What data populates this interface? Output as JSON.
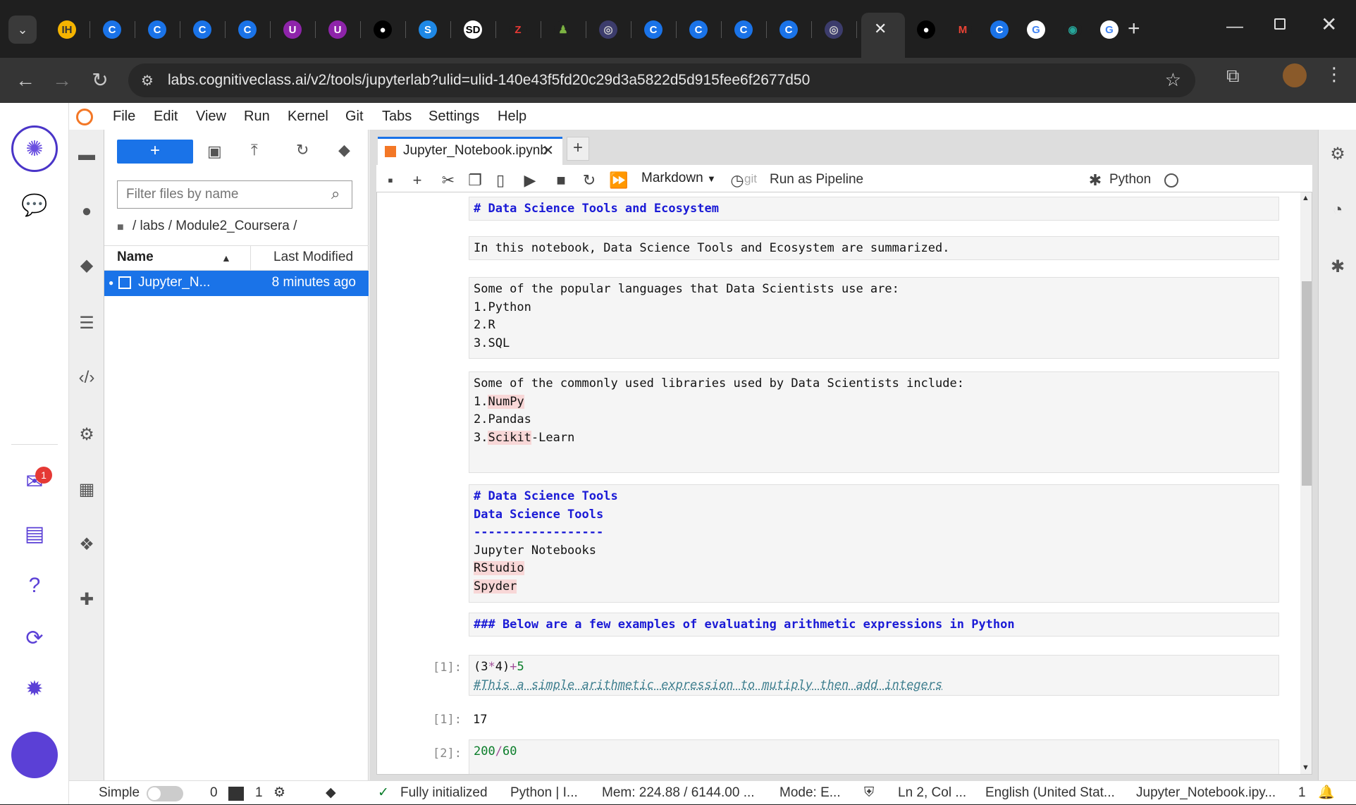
{
  "browser": {
    "tabs": [
      {
        "name": "ih-tab",
        "glyph": "IH",
        "color": "#f5b400",
        "text": "#333"
      },
      {
        "name": "cognitiveclass-tab",
        "glyph": "C",
        "color": "#1a73e8",
        "text": "#fff"
      },
      {
        "name": "cognitiveclass-tab",
        "glyph": "C",
        "color": "#1a73e8",
        "text": "#fff"
      },
      {
        "name": "cognitiveclass-tab",
        "glyph": "C",
        "color": "#1a73e8",
        "text": "#fff"
      },
      {
        "name": "cognitiveclass-tab",
        "glyph": "C",
        "color": "#1a73e8",
        "text": "#fff"
      },
      {
        "name": "u-tab",
        "glyph": "U",
        "color": "#8e24aa",
        "text": "#fff"
      },
      {
        "name": "u-tab",
        "glyph": "U",
        "color": "#8e24aa",
        "text": "#fff"
      },
      {
        "name": "github-tab",
        "glyph": "●",
        "color": "#000",
        "text": "#fff"
      },
      {
        "name": "s-tab",
        "glyph": "S",
        "color": "#1e88e5",
        "text": "#fff"
      },
      {
        "name": "sd-tab",
        "glyph": "SD",
        "color": "#fff",
        "text": "#000"
      },
      {
        "name": "z-tab",
        "glyph": "Z",
        "color": "#1f1f1f",
        "text": "#e53935"
      },
      {
        "name": "chess-tab",
        "glyph": "♟",
        "color": "#1f1f1f",
        "text": "#7cb342"
      },
      {
        "name": "circle-tab",
        "glyph": "◎",
        "color": "#3c3c6c",
        "text": "#ccc"
      },
      {
        "name": "cognitiveclass-tab",
        "glyph": "C",
        "color": "#1a73e8",
        "text": "#fff"
      },
      {
        "name": "cognitiveclass-tab",
        "glyph": "C",
        "color": "#1a73e8",
        "text": "#fff"
      },
      {
        "name": "cognitiveclass-tab",
        "glyph": "C",
        "color": "#1a73e8",
        "text": "#fff"
      },
      {
        "name": "cognitiveclass-tab",
        "glyph": "C",
        "color": "#1a73e8",
        "text": "#fff"
      },
      {
        "name": "circle-tab",
        "glyph": "◎",
        "color": "#3c3c6c",
        "text": "#ccc"
      }
    ],
    "tabs_after": [
      {
        "name": "github-tab",
        "glyph": "●",
        "color": "#000",
        "text": "#fff"
      },
      {
        "name": "gmail-tab",
        "glyph": "M",
        "color": "#1f1f1f",
        "text": "#ea4335"
      },
      {
        "name": "cognitiveclass-tab",
        "glyph": "C",
        "color": "#1a73e8",
        "text": "#fff"
      },
      {
        "name": "google-tab",
        "glyph": "G",
        "color": "#fff",
        "text": "#4285f4"
      },
      {
        "name": "eye-tab",
        "glyph": "◉",
        "color": "#1f1f1f",
        "text": "#26a69a"
      },
      {
        "name": "google-tab",
        "glyph": "G",
        "color": "#fff",
        "text": "#4285f4"
      }
    ],
    "active_tab_close": "✕",
    "new_tab": "+",
    "url": "labs.cognitiveclass.ai/v2/tools/jupyterlab?ulid=ulid-140e43f5fd20c29d3a5822d5d915fee6f2677d50"
  },
  "menu": [
    "File",
    "Edit",
    "View",
    "Run",
    "Kernel",
    "Git",
    "Tabs",
    "Settings",
    "Help"
  ],
  "filebrowser": {
    "new_label": "+",
    "filter_placeholder": "Filter files by name",
    "breadcrumb": "/ labs / Module2_Coursera /",
    "col_name": "Name",
    "col_modified": "Last Modified",
    "file_name": "Jupyter_N...",
    "file_modified": "8 minutes ago"
  },
  "notebook": {
    "tab_title": "Jupyter_Notebook.ipynb",
    "cell_type": "Markdown",
    "git_label": "git",
    "run_pipeline": "Run as Pipeline",
    "kernel": "Python"
  },
  "cells": {
    "c1": "# Data Science Tools and Ecosystem",
    "c2": "In this notebook, Data Science Tools and Ecosystem are summarized.",
    "c3a": "Some of the popular languages that Data Scientists use are:",
    "c3b": "1.Python",
    "c3c": "2.R",
    "c3d": "3.SQL",
    "c4a": "Some of the commonly used libraries used by Data Scientists include:",
    "c4b": "1.",
    "c4b2": "NumPy",
    "c4c": "2.Pandas",
    "c4d": "3.",
    "c4d2": "Scikit",
    "c4d3": "-Learn",
    "c5a": "# Data Science Tools",
    "c5b": "Data Science Tools",
    "c5c": "------------------",
    "c5d": "Jupyter Notebooks",
    "c5e": "RStudio",
    "c5f": "Spyder",
    "c6": "### Below are a few examples of evaluating arithmetic expressions in Python",
    "p1": "[1]:",
    "c7a1": "(3",
    "c7a2": "*",
    "c7a3": "4)",
    "c7a4": "+",
    "c7a5": "5",
    "c7b": "#This a simple arithmetic expression to mutiply then add integers",
    "po1": "[1]:",
    "o1": "17",
    "p2": "[2]:",
    "c8a": "200",
    "c8b": "/",
    "c8c": "60"
  },
  "status": {
    "mode_label": "Simple",
    "count0": "0",
    "count1": "1",
    "init": "Fully initialized",
    "kernel": "Python | I...",
    "mem": "Mem: 224.88 / 6144.00 ...",
    "mode": "Mode: E...",
    "cursor": "Ln 2, Col ...",
    "lang": "English (United Stat...",
    "file": "Jupyter_Notebook.ipy...",
    "notif": "1"
  },
  "badge": "1"
}
